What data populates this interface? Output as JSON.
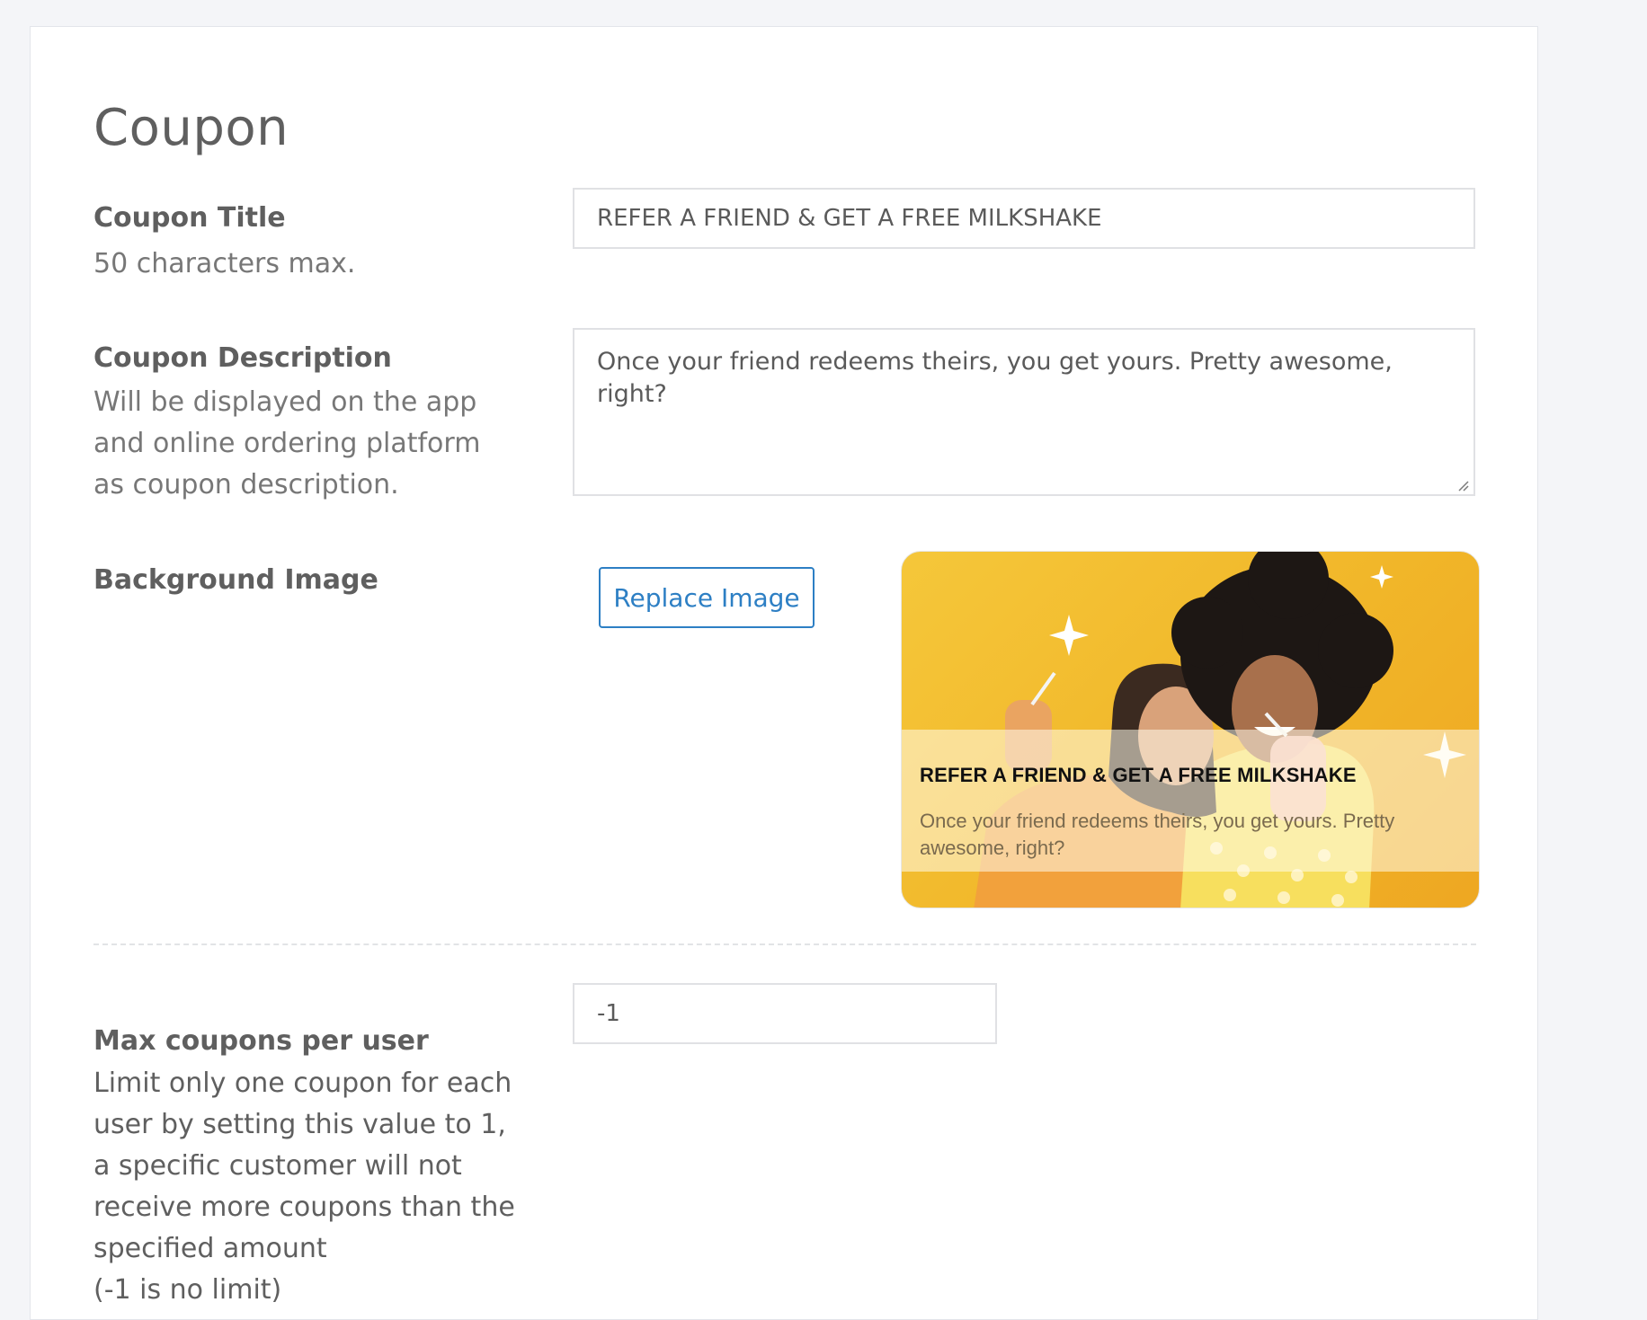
{
  "page": {
    "title": "Coupon"
  },
  "coupon_title": {
    "label": "Coupon Title",
    "hint": "50 characters max.",
    "value": "REFER A FRIEND & GET A FREE MILKSHAKE"
  },
  "coupon_description": {
    "label": "Coupon Description",
    "hint": "Will be displayed on the app and online ordering platform as coupon description.",
    "value": "Once your friend redeems theirs, you get yours. Pretty awesome, right?"
  },
  "background_image": {
    "label": "Background Image",
    "replace_button": "Replace Image",
    "preview_title": "REFER A FRIEND & GET A FREE MILKSHAKE",
    "preview_description": "Once your friend redeems theirs, you get yours. Pretty awesome, right?"
  },
  "max_coupons": {
    "label": "Max coupons per user",
    "hint": "Limit only one coupon for each user by setting this value to 1, a specific customer will not receive more coupons than the specified amount",
    "hint_note": "(-1 is no limit)",
    "value": "-1"
  },
  "colors": {
    "accent": "#2d7fc4",
    "preview_background": "#f4c233"
  }
}
